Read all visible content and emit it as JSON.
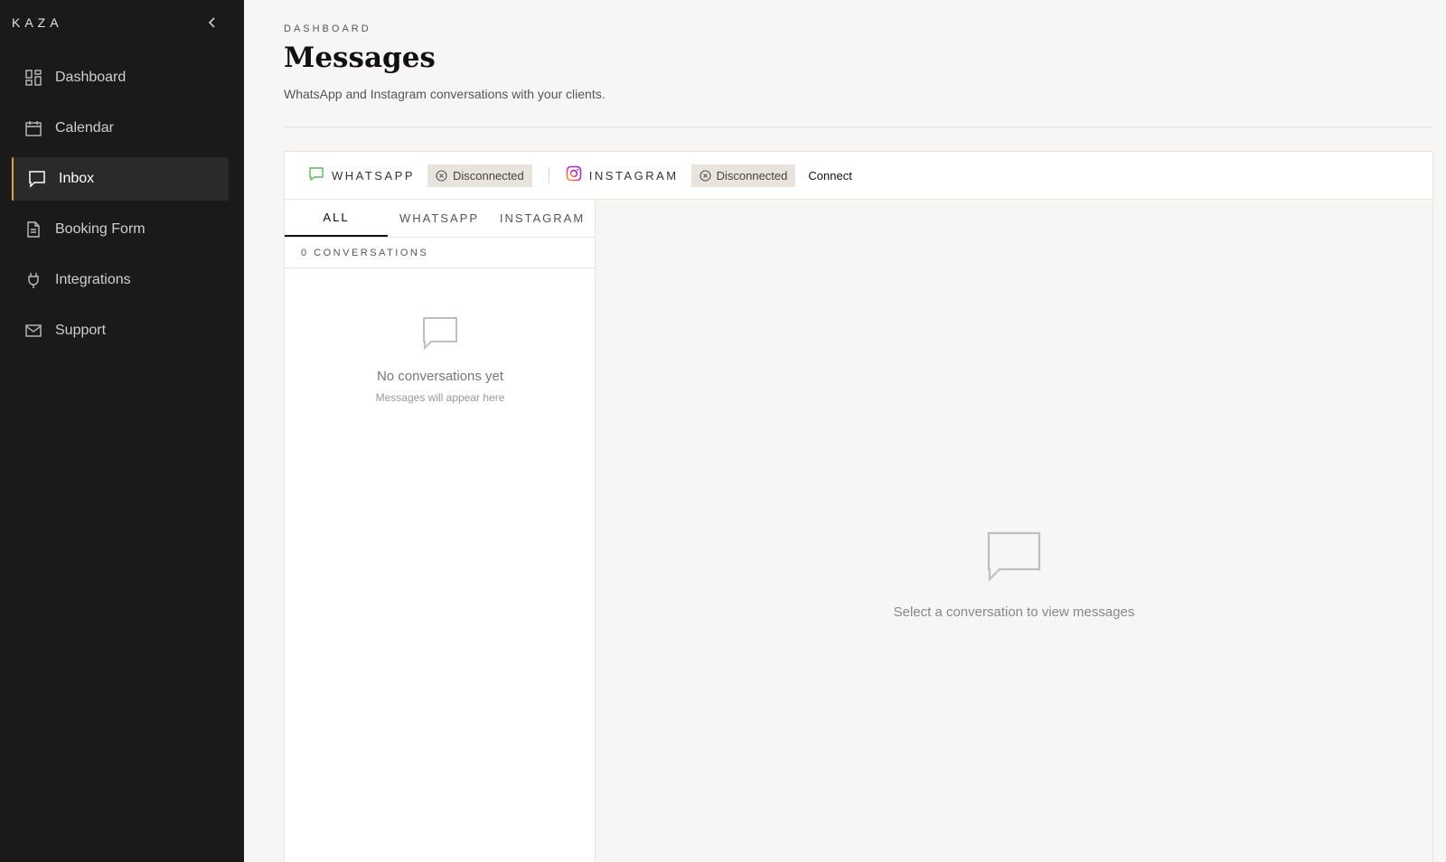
{
  "sidebar": {
    "brand": "KAZA",
    "items": [
      {
        "label": "Dashboard",
        "icon": "dashboard-icon"
      },
      {
        "label": "Calendar",
        "icon": "calendar-icon"
      },
      {
        "label": "Inbox",
        "icon": "chat-icon",
        "active": true
      },
      {
        "label": "Booking Form",
        "icon": "document-icon"
      },
      {
        "label": "Integrations",
        "icon": "plug-icon"
      },
      {
        "label": "Support",
        "icon": "mail-icon"
      }
    ]
  },
  "header": {
    "breadcrumb": "DASHBOARD",
    "title": "Messages",
    "subtitle": "WhatsApp and Instagram conversations with your clients."
  },
  "channels": {
    "whatsapp": {
      "label": "WHATSAPP",
      "status": "Disconnected",
      "color": "#5cb85c"
    },
    "instagram": {
      "label": "INSTAGRAM",
      "status": "Disconnected",
      "action": "Connect"
    }
  },
  "tabs": [
    "ALL",
    "WHATSAPP",
    "INSTAGRAM"
  ],
  "conversation_count": "0 CONVERSATIONS",
  "empty_list": {
    "title": "No conversations yet",
    "subtitle": "Messages will appear here"
  },
  "empty_view": {
    "text": "Select a conversation to view messages"
  },
  "colors": {
    "sidebar_bg": "#1a1a1a",
    "accent": "#d4a843",
    "badge_bg": "#e8e4dd",
    "page_bg": "#f7f6f4"
  }
}
